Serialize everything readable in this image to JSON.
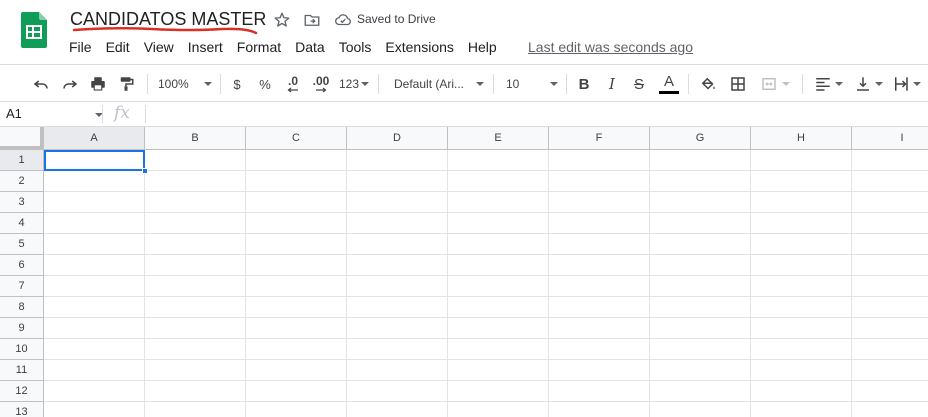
{
  "doc": {
    "title": "CANDIDATOS MASTER",
    "saved_status": "Saved to Drive",
    "last_edit": "Last edit was seconds ago"
  },
  "menu": [
    "File",
    "Edit",
    "View",
    "Insert",
    "Format",
    "Data",
    "Tools",
    "Extensions",
    "Help"
  ],
  "toolbar": {
    "zoom": "100%",
    "currency": "$",
    "percent": "%",
    "decrease_decimal": ".0",
    "increase_decimal": ".00",
    "more_formats": "123",
    "font": "Default (Ari...",
    "font_size": "10",
    "bold": "B",
    "italic": "I",
    "strikethrough": "S",
    "text_color": "A"
  },
  "formula_bar": {
    "name_box": "A1",
    "fx": "fx"
  },
  "grid": {
    "columns": [
      "A",
      "B",
      "C",
      "D",
      "E",
      "F",
      "G",
      "H",
      "I"
    ],
    "rows": [
      "1",
      "2",
      "3",
      "4",
      "5",
      "6",
      "7",
      "8",
      "9",
      "10",
      "11",
      "12",
      "13"
    ],
    "active_cell": "A1"
  },
  "colors": {
    "accent": "#1a73e8",
    "sheets_green": "#0f9d58",
    "title_underline": "#d93025"
  }
}
